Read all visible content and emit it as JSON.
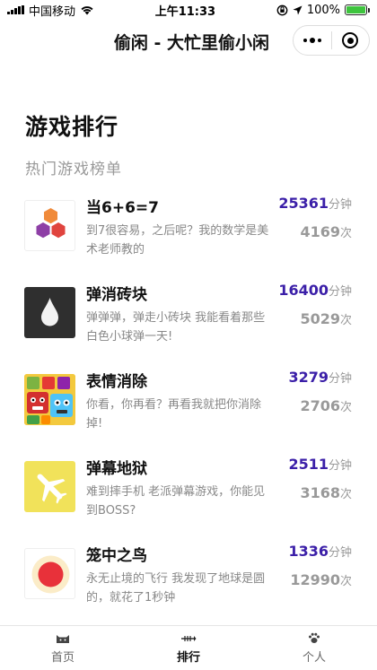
{
  "status_bar": {
    "carrier": "中国移动",
    "time": "上午11:33",
    "battery": "100%"
  },
  "nav": {
    "title": "偷闲 - 大忙里偷小闲"
  },
  "header": {
    "title": "游戏排行",
    "subtitle": "热门游戏榜单"
  },
  "games": [
    {
      "name": "当6+6=7",
      "desc": "到7很容易，之后呢？我的数学是美术老师教的",
      "minutes": "25361",
      "minutes_unit": "分钟",
      "plays": "4169",
      "plays_unit": "次",
      "icon": "hexagon-blocks-icon"
    },
    {
      "name": "弹消砖块",
      "desc": "弹弹弹，弹走小砖块 我能看着那些白色小球弹一天!",
      "minutes": "16400",
      "minutes_unit": "分钟",
      "plays": "5029",
      "plays_unit": "次",
      "icon": "white-drop-icon"
    },
    {
      "name": "表情消除",
      "desc": "你看，你再看？再看我就把你消除掉!",
      "minutes": "3279",
      "minutes_unit": "分钟",
      "plays": "2706",
      "plays_unit": "次",
      "icon": "emoji-tiles-icon"
    },
    {
      "name": "弹幕地狱",
      "desc": "难到摔手机 老派弹幕游戏，你能见到BOSS?",
      "minutes": "2511",
      "minutes_unit": "分钟",
      "plays": "3168",
      "plays_unit": "次",
      "icon": "airplane-icon"
    },
    {
      "name": "笼中之鸟",
      "desc": "永无止境的飞行 我发现了地球是圆的，就花了1秒钟",
      "minutes": "1336",
      "minutes_unit": "分钟",
      "plays": "12990",
      "plays_unit": "次",
      "icon": "red-circle-icon"
    }
  ],
  "tabs": [
    {
      "label": "首页",
      "icon": "cat-icon"
    },
    {
      "label": "排行",
      "icon": "fish-bone-icon"
    },
    {
      "label": "个人",
      "icon": "paw-icon"
    }
  ],
  "colors": {
    "minutes_accent": "#3b1fa8",
    "battery": "#3ec43e"
  }
}
